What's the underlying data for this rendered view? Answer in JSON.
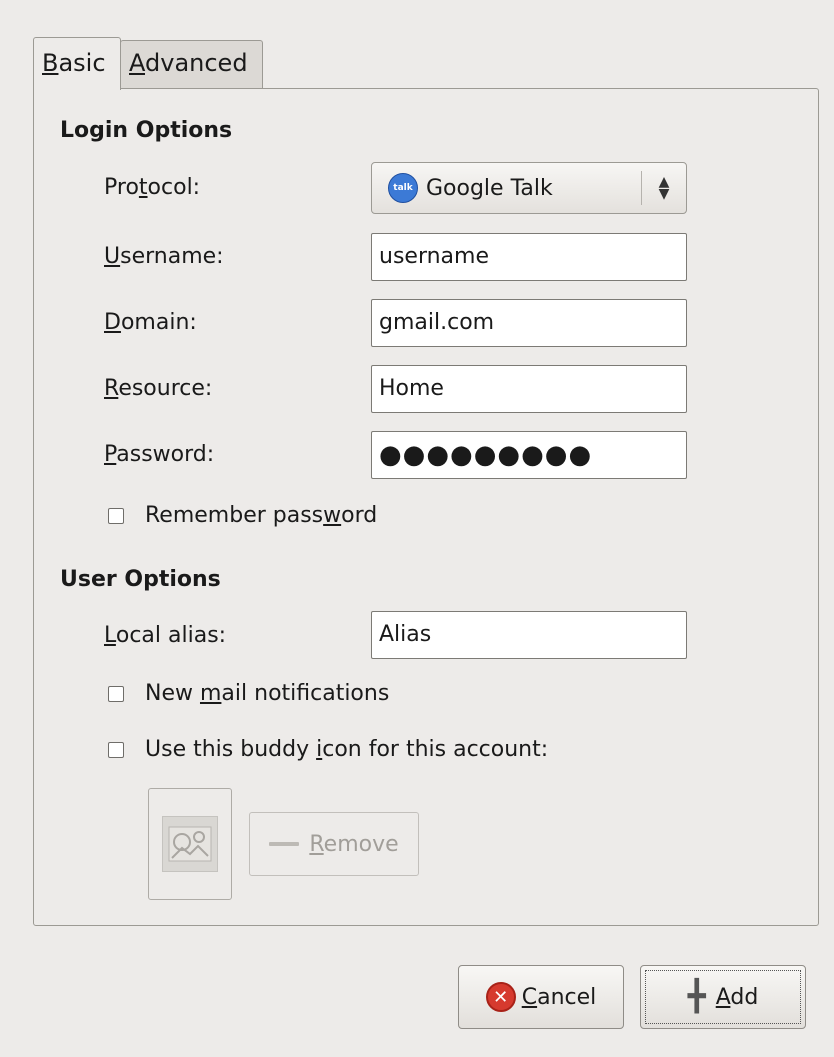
{
  "tabs": {
    "basic": {
      "label_first": "B",
      "label_rest": "asic"
    },
    "advanced": {
      "label_first": "A",
      "label_rest": "dvanced"
    }
  },
  "login_options": {
    "title": "Login Options",
    "protocol": {
      "label_pre": "Pro",
      "label_u": "t",
      "label_post": "ocol:",
      "value": "Google Talk",
      "icon": "google-talk-icon",
      "icon_text": "talk"
    },
    "username": {
      "label_u": "U",
      "label_post": "sername:",
      "value": "username"
    },
    "domain": {
      "label_u": "D",
      "label_post": "omain:",
      "value": "gmail.com"
    },
    "resource": {
      "label_u": "R",
      "label_post": "esource:",
      "value": "Home"
    },
    "password": {
      "label_u": "P",
      "label_post": "assword:",
      "value": "●●●●●●●●●"
    },
    "remember": {
      "label_pre": "Remember pass",
      "label_u": "w",
      "label_post": "ord",
      "checked": false
    }
  },
  "user_options": {
    "title": "User Options",
    "alias": {
      "label_u": "L",
      "label_post": "ocal alias:",
      "value": "Alias"
    },
    "mail": {
      "label_pre": "New ",
      "label_u": "m",
      "label_post": "ail notifications",
      "checked": false
    },
    "buddy_icon": {
      "label_pre": "Use this buddy ",
      "label_u": "i",
      "label_post": "con for this account:",
      "checked": false
    },
    "remove": {
      "label_u": "R",
      "label_post": "emove"
    }
  },
  "buttons": {
    "cancel": {
      "label_u": "C",
      "label_post": "ancel"
    },
    "add": {
      "label_u": "A",
      "label_post": "dd"
    }
  }
}
